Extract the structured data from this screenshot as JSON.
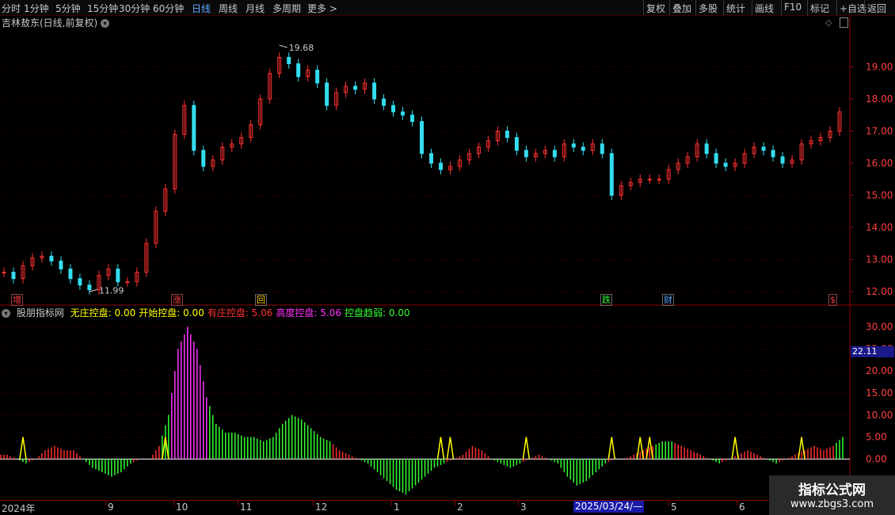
{
  "toolbar": {
    "periods": [
      "分时",
      "1分钟",
      "5分钟",
      "15分钟",
      "30分钟",
      "60分钟",
      "日线",
      "周线",
      "月线",
      "多周期",
      "更多"
    ],
    "active_period": "日线",
    "more_arrow": ">",
    "right_buttons": [
      "复权",
      "叠加",
      "多股",
      "统计",
      "画线",
      "F10",
      "标记",
      "+自选",
      "返回"
    ]
  },
  "header": {
    "stock_title": "吉林敖东(日线,前复权)",
    "dropdown_icon": "chevron-down-icon"
  },
  "price_axis": {
    "labels": [
      "19.00",
      "18.00",
      "17.00",
      "16.00",
      "15.00",
      "14.00",
      "13.00",
      "12.00"
    ],
    "current_price_line_color": "#ff4040"
  },
  "annotations": {
    "high": "19.68",
    "low": "11.99"
  },
  "event_badges": [
    {
      "label": "增",
      "color": "#ff4040"
    },
    {
      "label": "涨",
      "color": "#ff4040"
    },
    {
      "label": "回",
      "color": "#ffcc00"
    },
    {
      "label": "跌",
      "color": "#33ff33"
    },
    {
      "label": "财",
      "color": "#5fa8ff"
    },
    {
      "label": "$",
      "color": "#ff4040"
    }
  ],
  "indicator": {
    "name": "股朋指标网",
    "items": [
      {
        "label": "无庄控盘:",
        "value": "0.00",
        "color": "#ffff00"
      },
      {
        "label": "开始控盘:",
        "value": "0.00",
        "color": "#ffff00"
      },
      {
        "label": "有庄控盘:",
        "value": "5.06",
        "color": "#ff3030"
      },
      {
        "label": "高度控盘:",
        "value": "5.06",
        "color": "#ff33ff"
      },
      {
        "label": "控盘趋弱:",
        "value": "0.00",
        "color": "#33ff33"
      }
    ],
    "axis_labels": [
      "30.00",
      "25.00",
      "20.00",
      "15.00",
      "10.00",
      "5.00",
      "0.00"
    ],
    "current_value_tag": "22.11"
  },
  "date_axis": {
    "labels": [
      "2024年",
      "9",
      "10",
      "11",
      "12",
      "1",
      "2",
      "3",
      "5",
      "6"
    ],
    "current_date": "2025/03/24/—"
  },
  "chart_data": {
    "type": "candlestick",
    "title": "吉林敖东(日线,前复权)",
    "ylim": [
      11.7,
      20.1
    ],
    "high_point": 19.68,
    "low_point": 11.99,
    "segments_close": [
      12.6,
      12.4,
      12.8,
      13.05,
      13.1,
      12.95,
      12.7,
      12.4,
      12.2,
      12.05,
      12.5,
      12.7,
      12.3,
      12.3,
      12.6,
      13.5,
      14.5,
      15.2,
      16.9,
      17.8,
      16.4,
      15.9,
      16.1,
      16.5,
      16.6,
      16.8,
      17.2,
      18.0,
      18.8,
      19.3,
      19.1,
      18.7,
      18.9,
      18.5,
      17.8,
      18.2,
      18.4,
      18.3,
      18.5,
      18.0,
      17.8,
      17.6,
      17.5,
      17.3,
      16.3,
      16.0,
      15.8,
      15.9,
      16.1,
      16.3,
      16.5,
      16.7,
      17.0,
      16.8,
      16.4,
      16.2,
      16.3,
      16.4,
      16.2,
      16.6,
      16.5,
      16.4,
      16.6,
      16.3,
      15.0,
      15.3,
      15.4,
      15.5,
      15.5,
      15.5,
      15.8,
      16.0,
      16.2,
      16.6,
      16.3,
      16.0,
      15.9,
      16.0,
      16.3,
      16.5,
      16.4,
      16.2,
      16.0,
      16.1,
      16.6,
      16.7,
      16.8,
      17.0,
      17.6
    ],
    "indicator_series": [
      {
        "name": "有庄控盘",
        "color": "#ff3030"
      },
      {
        "name": "高度控盘",
        "color": "#ff33ff"
      },
      {
        "name": "控盘趋弱",
        "color": "#33ff33"
      },
      {
        "name": "无庄控盘",
        "color": "#ffff00"
      }
    ],
    "indicator_values": [
      1,
      0,
      -1,
      0,
      2,
      3,
      2,
      2,
      0,
      -2,
      -3,
      -4,
      -3,
      -1,
      0,
      0,
      3,
      10,
      25,
      30,
      25,
      14,
      8,
      6,
      6,
      5,
      5,
      4,
      5,
      8,
      10,
      9,
      7,
      5,
      4,
      2,
      1,
      0,
      -1,
      -3,
      -5,
      -7,
      -8,
      -6,
      -4,
      -2,
      -1,
      0,
      1,
      3,
      2,
      0,
      -1,
      -2,
      -1,
      0,
      1,
      0,
      -1,
      -4,
      -6,
      -5,
      -3,
      -1,
      0,
      0,
      1,
      2,
      3,
      4,
      4,
      3,
      2,
      1,
      0,
      -1,
      0,
      1,
      2,
      1,
      0,
      -1,
      0,
      1,
      2,
      3,
      2,
      3,
      5
    ],
    "indicator_ylim": [
      -10,
      31
    ]
  }
}
